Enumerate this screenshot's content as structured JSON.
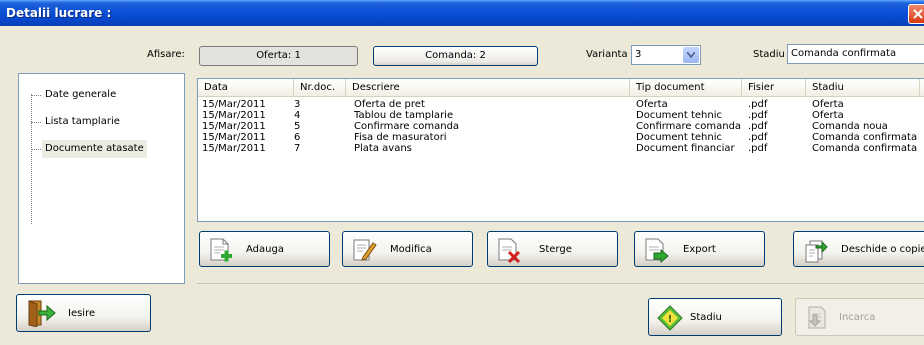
{
  "window": {
    "title": "Detalii lucrare :"
  },
  "afisare": {
    "label": "Afisare:",
    "oferta_button": "Oferta: 1",
    "comanda_button": "Comanda: 2"
  },
  "varianta": {
    "label": "Varianta",
    "value": "3"
  },
  "stadiu": {
    "label": "Stadiu",
    "value": "Comanda confirmata"
  },
  "tree": {
    "items": [
      {
        "label": "Date generale"
      },
      {
        "label": "Lista tamplarie"
      },
      {
        "label": "Documente atasate"
      }
    ]
  },
  "table": {
    "columns": [
      "Data",
      "Nr.doc.",
      "Descriere",
      "Tip document",
      "Fisier",
      "Stadiu"
    ],
    "rows": [
      [
        "15/Mar/2011",
        "3",
        "Oferta de pret",
        "Oferta",
        ".pdf",
        "Oferta"
      ],
      [
        "15/Mar/2011",
        "4",
        "Tablou de tamplarie",
        "Document tehnic",
        ".pdf",
        "Oferta"
      ],
      [
        "15/Mar/2011",
        "5",
        "Confirmare comanda",
        "Confirmare comanda",
        ".pdf",
        "Comanda noua"
      ],
      [
        "15/Mar/2011",
        "6",
        "Fisa de masuratori",
        "Document tehnic",
        ".pdf",
        "Comanda confirmata"
      ],
      [
        "15/Mar/2011",
        "7",
        "Plata avans",
        "Document financiar",
        ".pdf",
        "Comanda confirmata"
      ]
    ]
  },
  "actions": {
    "adauga": "Adauga",
    "modifica": "Modifica",
    "sterge": "Sterge",
    "export": "Export",
    "deschide": "Deschide o copie"
  },
  "footer": {
    "iesire": "Iesire",
    "stadiu": "Stadiu",
    "incarca": "Incarca"
  }
}
